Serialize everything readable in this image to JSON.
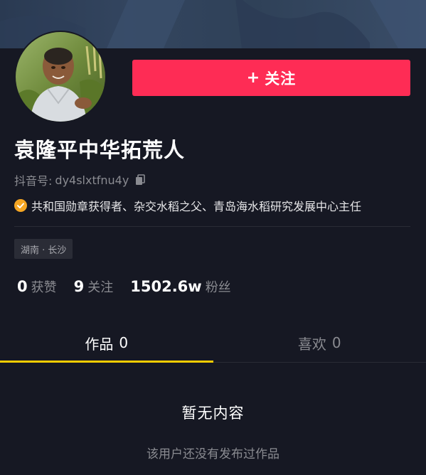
{
  "profile": {
    "name": "袁隆平中华拓荒人",
    "id_label": "抖音号:",
    "id_value": "dy4slxtfnu4y",
    "verification": "共和国勋章获得者、杂交水稻之父、青岛海水稻研究发展中心主任",
    "location": "湖南 · 长沙"
  },
  "actions": {
    "follow_label": "关注",
    "follow_plus": "+"
  },
  "stats": {
    "likes_count": "0",
    "likes_label": "获赞",
    "following_count": "9",
    "following_label": "关注",
    "followers_count": "1502.6w",
    "followers_label": "粉丝"
  },
  "tabs": [
    {
      "label": "作品",
      "count": "0",
      "active": true
    },
    {
      "label": "喜欢",
      "count": "0",
      "active": false
    }
  ],
  "empty_state": {
    "title": "暂无内容",
    "description": "该用户还没有发布过作品"
  },
  "colors": {
    "background": "#161823",
    "follow_button": "#fe2c55",
    "tab_indicator": "#facd00",
    "verify_badge": "#f5a623"
  },
  "icons": {
    "copy": "copy-icon",
    "verify": "verified-badge-icon"
  }
}
